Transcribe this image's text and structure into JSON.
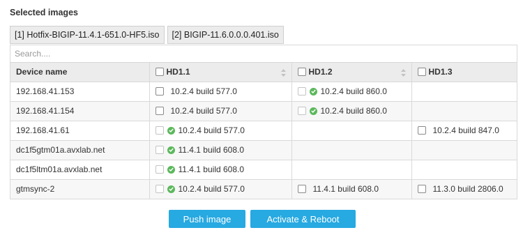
{
  "title": "Selected images",
  "image_tabs": [
    "[1] Hotfix-BIGIP-11.4.1-651.0-HF5.iso",
    "[2] BIGIP-11.6.0.0.0.401.iso"
  ],
  "search": {
    "placeholder": "Search...."
  },
  "columns": {
    "device": "Device name",
    "hd1": "HD1.1",
    "hd2": "HD1.2",
    "hd3": "HD1.3"
  },
  "rows": [
    {
      "device": "192.168.41.153",
      "hd1": {
        "text": "10.2.4 build 577.0",
        "active": false
      },
      "hd2": {
        "text": "10.2.4 build 860.0",
        "active": true
      },
      "hd3": null
    },
    {
      "device": "192.168.41.154",
      "hd1": {
        "text": "10.2.4 build 577.0",
        "active": false
      },
      "hd2": {
        "text": "10.2.4 build 860.0",
        "active": true
      },
      "hd3": null
    },
    {
      "device": "192.168.41.61",
      "hd1": {
        "text": "10.2.4 build 577.0",
        "active": true
      },
      "hd2": null,
      "hd3": {
        "text": "10.2.4 build 847.0",
        "active": false
      }
    },
    {
      "device": "dc1f5gtm01a.avxlab.net",
      "hd1": {
        "text": "11.4.1 build 608.0",
        "active": true
      },
      "hd2": null,
      "hd3": null
    },
    {
      "device": "dc1f5ltm01a.avxlab.net",
      "hd1": {
        "text": "11.4.1 build 608.0",
        "active": true
      },
      "hd2": null,
      "hd3": null
    },
    {
      "device": "gtmsync-2",
      "hd1": {
        "text": "10.2.4 build 577.0",
        "active": true
      },
      "hd2": {
        "text": "11.4.1 build 608.0",
        "active": false
      },
      "hd3": {
        "text": "11.3.0 build 2806.0",
        "active": false
      }
    }
  ],
  "buttons": {
    "push": "Push image",
    "reboot": "Activate & Reboot"
  },
  "colors": {
    "accent": "#27a9e1",
    "active_check": "#5cb85c"
  },
  "icons": {
    "active": "check-circle-icon",
    "sort": "sort-icon"
  }
}
